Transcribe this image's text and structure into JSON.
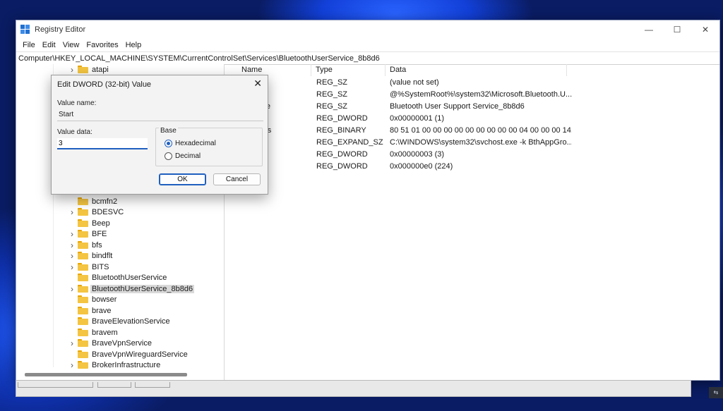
{
  "window": {
    "title": "Registry Editor",
    "controls": {
      "minimize": "—",
      "maximize": "☐",
      "close": "✕"
    },
    "menu": [
      "File",
      "Edit",
      "View",
      "Favorites",
      "Help"
    ],
    "address": "Computer\\HKEY_LOCAL_MACHINE\\SYSTEM\\CurrentControlSet\\Services\\BluetoothUserService_8b8d6"
  },
  "tree": {
    "items": [
      {
        "label": "atapi",
        "expandable": true
      },
      {
        "label": "bcmfn2",
        "expandable": false
      },
      {
        "label": "BDESVC",
        "expandable": true
      },
      {
        "label": "Beep",
        "expandable": false
      },
      {
        "label": "BFE",
        "expandable": true
      },
      {
        "label": "bfs",
        "expandable": true
      },
      {
        "label": "bindflt",
        "expandable": true
      },
      {
        "label": "BITS",
        "expandable": true
      },
      {
        "label": "BluetoothUserService",
        "expandable": false
      },
      {
        "label": "BluetoothUserService_8b8d6",
        "expandable": true,
        "selected": true
      },
      {
        "label": "bowser",
        "expandable": false
      },
      {
        "label": "brave",
        "expandable": false
      },
      {
        "label": "BraveElevationService",
        "expandable": false
      },
      {
        "label": "bravem",
        "expandable": false
      },
      {
        "label": "BraveVpnService",
        "expandable": true
      },
      {
        "label": "BraveVpnWireguardService",
        "expandable": false
      },
      {
        "label": "BrokerInfrastructure",
        "expandable": true
      }
    ]
  },
  "list": {
    "columns": [
      "Name",
      "Type",
      "Data"
    ],
    "rows": [
      {
        "name": "ult)",
        "type": "REG_SZ",
        "data": "(value not set)"
      },
      {
        "name": "ription",
        "type": "REG_SZ",
        "data": "@%SystemRoot%\\system32\\Microsoft.Bluetooth.U..."
      },
      {
        "name": "ayName",
        "type": "REG_SZ",
        "data": "Bluetooth User Support Service_8b8d6"
      },
      {
        "name": "Control",
        "type": "REG_DWORD",
        "data": "0x00000001 (1)"
      },
      {
        "name": "eActions",
        "type": "REG_BINARY",
        "data": "80 51 01 00 00 00 00 00 00 00 00 00 04 00 00 00 14..."
      },
      {
        "name": "ePath",
        "type": "REG_EXPAND_SZ",
        "data": "C:\\WINDOWS\\system32\\svchost.exe -k BthAppGro..."
      },
      {
        "name": "",
        "type": "REG_DWORD",
        "data": "0x00000003 (3)"
      },
      {
        "name": "",
        "type": "REG_DWORD",
        "data": "0x000000e0 (224)"
      }
    ]
  },
  "dialog": {
    "title": "Edit DWORD (32-bit) Value",
    "close": "✕",
    "value_name_label": "Value name:",
    "value_name": "Start",
    "value_data_label": "Value data:",
    "value_data": "3",
    "base_label": "Base",
    "base_options": [
      {
        "label": "Hexadecimal",
        "selected": true
      },
      {
        "label": "Decimal",
        "selected": false
      }
    ],
    "ok": "OK",
    "cancel": "Cancel"
  },
  "taskbar": {
    "corner_glyph": "⇆"
  }
}
